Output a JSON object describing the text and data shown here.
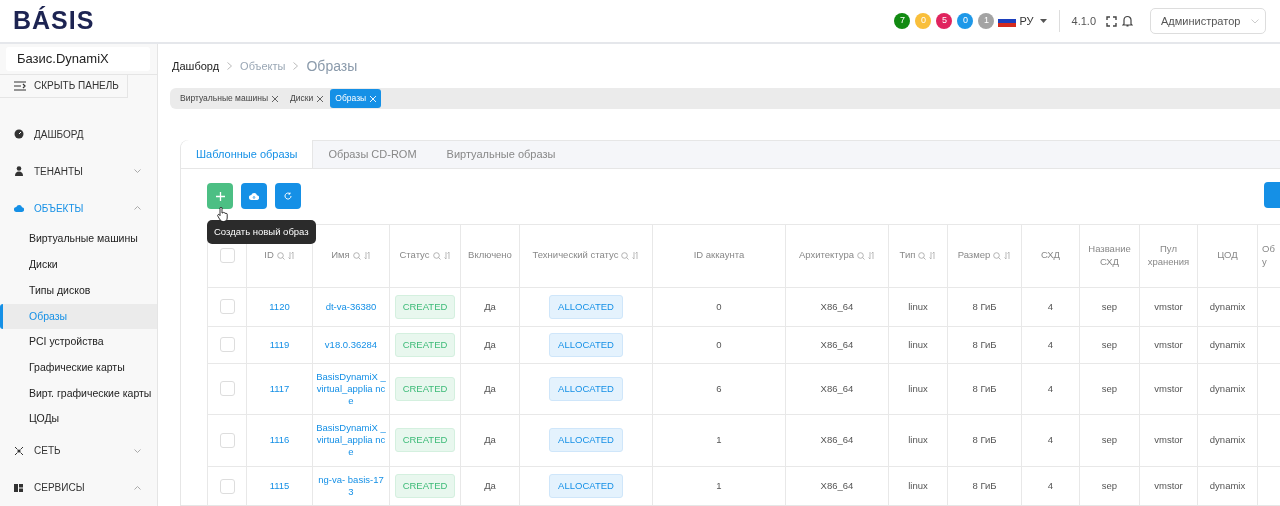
{
  "header": {
    "logo": "BÁSIS",
    "counters": [
      {
        "value": "7",
        "color": "#128a12"
      },
      {
        "value": "0",
        "color": "#f9bf3b"
      },
      {
        "value": "5",
        "color": "#e0245e"
      },
      {
        "value": "0",
        "color": "#1e98e8"
      },
      {
        "value": "1",
        "color": "#a3a3a3"
      }
    ],
    "language": "РУ",
    "version": "4.1.0",
    "user": "Администратор"
  },
  "sidebar": {
    "title": "Базис.DynamiX",
    "collapse": "СКРЫТЬ ПАНЕЛЬ",
    "items": [
      {
        "label": "ДАШБОРД"
      },
      {
        "label": "ТЕНАНТЫ",
        "expanded": false
      },
      {
        "label": "ОБЪЕКТЫ",
        "expanded": true,
        "children": [
          {
            "label": "Виртуальные машины",
            "selected": false
          },
          {
            "label": "Диски",
            "selected": false
          },
          {
            "label": "Типы дисков",
            "selected": false
          },
          {
            "label": "Образы",
            "selected": true
          },
          {
            "label": "PCI устройства",
            "selected": false
          },
          {
            "label": "Графические карты",
            "selected": false
          },
          {
            "label": "Вирт. графические карты",
            "selected": false
          },
          {
            "label": "ЦОДы",
            "selected": false
          }
        ]
      },
      {
        "label": "СЕТЬ",
        "expanded": false
      },
      {
        "label": "СЕРВИСЫ",
        "expanded": true
      }
    ]
  },
  "breadcrumbs": [
    "Дашборд",
    "Объекты",
    "Образы"
  ],
  "open_tabs": [
    {
      "label": "Виртуальные машины",
      "selected": false
    },
    {
      "label": "Диски",
      "selected": false
    },
    {
      "label": "Образы",
      "selected": true
    }
  ],
  "tabs": [
    {
      "label": "Шаблонные образы",
      "selected": true
    },
    {
      "label": "Образы CD-ROM",
      "selected": false
    },
    {
      "label": "Виртуальные образы",
      "selected": false
    }
  ],
  "toolbar": {
    "tooltip": "Создать новый образ"
  },
  "table": {
    "all_checked": false,
    "columns": [
      {
        "label": "ID",
        "filter": true,
        "sort": true
      },
      {
        "label": "Имя",
        "filter": true,
        "sort": true
      },
      {
        "label": "Статус",
        "filter": true,
        "sort": true
      },
      {
        "label": "Включено",
        "filter": false,
        "sort": false
      },
      {
        "label": "Технический статус",
        "filter": true,
        "sort": true
      },
      {
        "label": "ID аккаунта",
        "filter": false,
        "sort": false
      },
      {
        "label": "Архитектура",
        "filter": true,
        "sort": true
      },
      {
        "label": "Тип",
        "filter": true,
        "sort": true
      },
      {
        "label": "Размер",
        "filter": true,
        "sort": true
      },
      {
        "label": "СХД",
        "filter": false,
        "sort": false
      },
      {
        "label": "Название СХД",
        "filter": false,
        "sort": false
      },
      {
        "label": "Пул хранения",
        "filter": false,
        "sort": false
      },
      {
        "label": "ЦОД",
        "filter": false,
        "sort": false
      },
      {
        "label": "Об у",
        "filter": false,
        "sort": false
      }
    ],
    "rows": [
      {
        "checked": false,
        "cells": [
          "1120",
          "dt-va-36380",
          "CREATED",
          "Да",
          "ALLOCATED",
          "0",
          "X86_64",
          "linux",
          "8 ГиБ",
          "4",
          "sep",
          "vmstor",
          "dynamix"
        ]
      },
      {
        "checked": false,
        "cells": [
          "1119",
          "v18.0.36284",
          "CREATED",
          "Да",
          "ALLOCATED",
          "0",
          "X86_64",
          "linux",
          "8 ГиБ",
          "4",
          "sep",
          "vmstor",
          "dynamix"
        ]
      },
      {
        "checked": false,
        "cells": [
          "1117",
          "BasisDynamiX _virtual_applia nce",
          "CREATED",
          "Да",
          "ALLOCATED",
          "6",
          "X86_64",
          "linux",
          "8 ГиБ",
          "4",
          "sep",
          "vmstor",
          "dynamix"
        ]
      },
      {
        "checked": false,
        "cells": [
          "1116",
          "BasisDynamiX _virtual_applia nce",
          "CREATED",
          "Да",
          "ALLOCATED",
          "1",
          "X86_64",
          "linux",
          "8 ГиБ",
          "4",
          "sep",
          "vmstor",
          "dynamix"
        ]
      },
      {
        "checked": false,
        "cells": [
          "1115",
          "ng-va- basis-173",
          "CREATED",
          "Да",
          "ALLOCATED",
          "1",
          "X86_64",
          "linux",
          "8 ГиБ",
          "4",
          "sep",
          "vmstor",
          "dynamix"
        ]
      }
    ]
  }
}
